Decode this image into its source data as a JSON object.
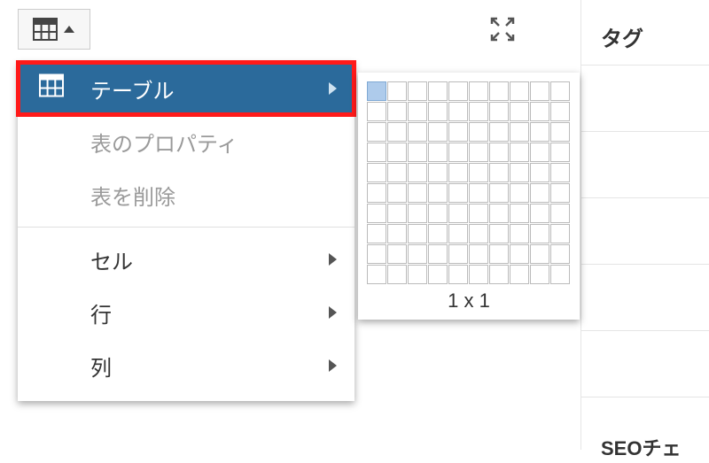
{
  "toolbar": {
    "table_button_name": "table-dropdown-button"
  },
  "side": {
    "title": "タグ",
    "bottom_text": "SEOチェ"
  },
  "menu": {
    "items": [
      {
        "label": "テーブル",
        "has_icon": true,
        "has_caret": true,
        "active": true,
        "disabled": false
      },
      {
        "label": "表のプロパティ",
        "has_icon": false,
        "has_caret": false,
        "active": false,
        "disabled": true
      },
      {
        "label": "表を削除",
        "has_icon": false,
        "has_caret": false,
        "active": false,
        "disabled": true
      },
      {
        "label": "セル",
        "has_icon": false,
        "has_caret": true,
        "active": false,
        "disabled": false
      },
      {
        "label": "行",
        "has_icon": false,
        "has_caret": true,
        "active": false,
        "disabled": false
      },
      {
        "label": "列",
        "has_icon": false,
        "has_caret": true,
        "active": false,
        "disabled": false
      }
    ]
  },
  "grid": {
    "rows": 10,
    "cols": 10,
    "sel_rows": 1,
    "sel_cols": 1,
    "label": "1 x 1"
  }
}
